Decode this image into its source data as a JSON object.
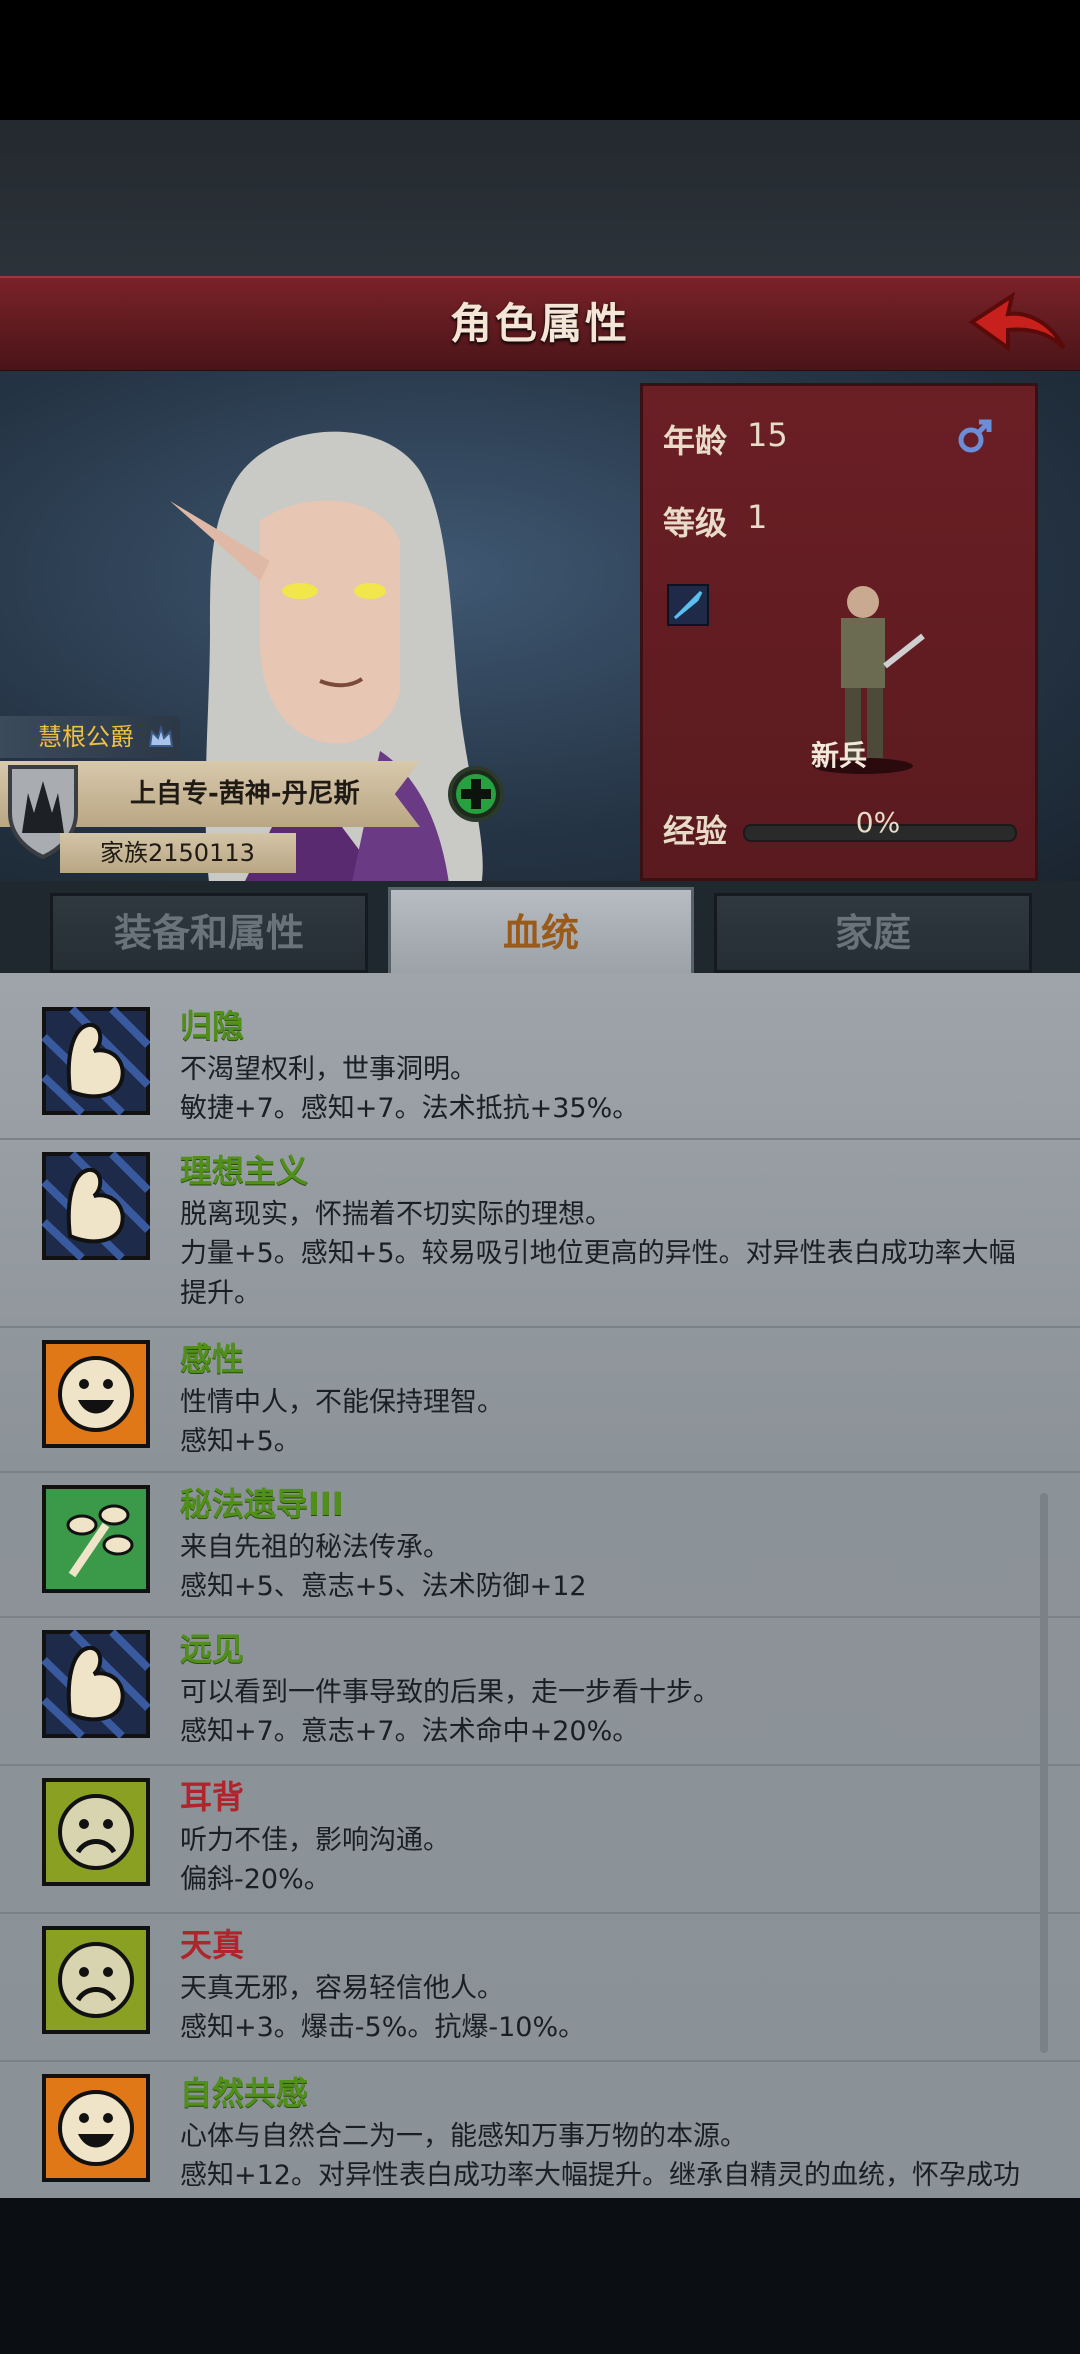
{
  "header": {
    "title": "角色属性",
    "back": "back-arrow-icon"
  },
  "character": {
    "rank": "慧根公爵",
    "name": "上自专-茜神-丹尼斯",
    "family": "家族2150113",
    "age_label": "年龄",
    "age": "15",
    "level_label": "等级",
    "level": "1",
    "class": "新兵",
    "exp_label": "经验",
    "exp_value": "0%",
    "exp_fraction": 0
  },
  "tabs": [
    {
      "label": "装备和属性"
    },
    {
      "label": "血统"
    },
    {
      "label": "家庭"
    }
  ],
  "traits": [
    {
      "name": "归隐",
      "type": "good",
      "icon": "arm-strength-icon",
      "desc": "不渴望权利，世事洞明。",
      "effect": "敏捷+7。感知+7。法术抵抗+35%。"
    },
    {
      "name": "理想主义",
      "type": "good",
      "icon": "arm-strength-icon",
      "desc": "脱离现实，怀揣着不切实际的理想。",
      "effect": "力量+5。感知+5。较易吸引地位更高的异性。对异性表白成功率大幅提升。"
    },
    {
      "name": "感性",
      "type": "good",
      "icon": "happy-face-icon",
      "desc": "性情中人，不能保持理智。",
      "effect": "感知+5。"
    },
    {
      "name": "秘法遗导III",
      "type": "good",
      "icon": "branch-icon",
      "desc": "来自先祖的秘法传承。",
      "effect": "感知+5、意志+5、法术防御+12"
    },
    {
      "name": "远见",
      "type": "good",
      "icon": "arm-strength-icon",
      "desc": "可以看到一件事导致的后果，走一步看十步。",
      "effect": "感知+7。意志+7。法术命中+20%。"
    },
    {
      "name": "耳背",
      "type": "bad",
      "icon": "sad-face-icon",
      "desc": "听力不佳，影响沟通。",
      "effect": "偏斜-20%。"
    },
    {
      "name": "天真",
      "type": "bad",
      "icon": "sad-face-icon",
      "desc": "天真无邪，容易轻信他人。",
      "effect": "感知+3。爆击-5%。抗爆-10%。"
    },
    {
      "name": "自然共感",
      "type": "good",
      "icon": "happy-face-icon",
      "desc": "心体与自然合二为一，能感知万事万物的本源。",
      "effect": "感知+12。对异性表白成功率大幅提升。继承自精灵的血统，怀孕成功"
    }
  ]
}
